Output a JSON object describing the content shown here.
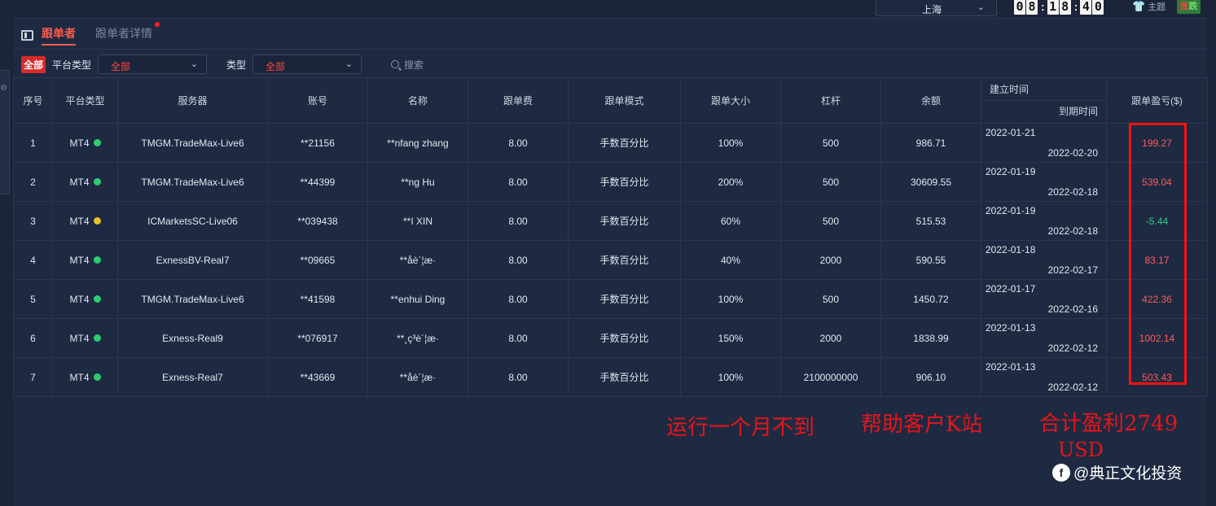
{
  "topbar": {
    "city": "上海",
    "clock_digits": [
      "0",
      "8",
      "1",
      "8",
      "4",
      "0"
    ],
    "theme_label": "主题",
    "zd_badge": {
      "z": "涨",
      "d": "跌"
    }
  },
  "tabs": [
    {
      "label": "跟单者",
      "active": true
    },
    {
      "label": "跟单者详情",
      "active": false
    }
  ],
  "filters": {
    "all_badge": "全部",
    "platform_label": "平台类型",
    "platform_value": "全部",
    "type_label": "类型",
    "type_value": "全部",
    "search_placeholder": "搜索"
  },
  "table": {
    "headers": {
      "seq": "序号",
      "platform": "平台类型",
      "server": "服务器",
      "account": "账号",
      "name": "名称",
      "fee": "跟单费",
      "mode": "跟单模式",
      "size": "跟单大小",
      "leverage": "杠杆",
      "balance": "余额",
      "created": "建立时间",
      "expiry": "到期时间",
      "pnl": "跟单盈亏($)"
    },
    "rows": [
      {
        "seq": "1",
        "platform": "MT4",
        "status": "green",
        "server": "TMGM.TradeMax-Live6",
        "account": "**21156",
        "name": "**nfang zhang",
        "fee": "8.00",
        "mode": "手数百分比",
        "size": "100%",
        "leverage": "500",
        "balance": "986.71",
        "created": "2022-01-21",
        "expiry": "2022-02-20",
        "pnl": "199.27",
        "pnl_sign": "pos"
      },
      {
        "seq": "2",
        "platform": "MT4",
        "status": "green",
        "server": "TMGM.TradeMax-Live6",
        "account": "**44399",
        "name": "**ng Hu",
        "fee": "8.00",
        "mode": "手数百分比",
        "size": "200%",
        "leverage": "500",
        "balance": "30609.55",
        "created": "2022-01-19",
        "expiry": "2022-02-18",
        "pnl": "539.04",
        "pnl_sign": "pos"
      },
      {
        "seq": "3",
        "platform": "MT4",
        "status": "yellow",
        "server": "ICMarketsSC-Live06",
        "account": "**039438",
        "name": "**I XIN",
        "fee": "8.00",
        "mode": "手数百分比",
        "size": "60%",
        "leverage": "500",
        "balance": "515.53",
        "created": "2022-01-19",
        "expiry": "2022-02-18",
        "pnl": "-5.44",
        "pnl_sign": "neg"
      },
      {
        "seq": "4",
        "platform": "MT4",
        "status": "green",
        "server": "ExnessBV-Real7",
        "account": "**09665",
        "name": "**åè´¦æ·",
        "fee": "8.00",
        "mode": "手数百分比",
        "size": "40%",
        "leverage": "2000",
        "balance": "590.55",
        "created": "2022-01-18",
        "expiry": "2022-02-17",
        "pnl": "83.17",
        "pnl_sign": "pos"
      },
      {
        "seq": "5",
        "platform": "MT4",
        "status": "green",
        "server": "TMGM.TradeMax-Live6",
        "account": "**41598",
        "name": "**enhui Ding",
        "fee": "8.00",
        "mode": "手数百分比",
        "size": "100%",
        "leverage": "500",
        "balance": "1450.72",
        "created": "2022-01-17",
        "expiry": "2022-02-16",
        "pnl": "422.36",
        "pnl_sign": "pos"
      },
      {
        "seq": "6",
        "platform": "MT4",
        "status": "green",
        "server": "Exness-Real9",
        "account": "**076917",
        "name": "**¸ç³è´¦æ·",
        "fee": "8.00",
        "mode": "手数百分比",
        "size": "150%",
        "leverage": "2000",
        "balance": "1838.99",
        "created": "2022-01-13",
        "expiry": "2022-02-12",
        "pnl": "1002.14",
        "pnl_sign": "pos"
      },
      {
        "seq": "7",
        "platform": "MT4",
        "status": "green",
        "server": "Exness-Real7",
        "account": "**43669",
        "name": "**åè´¦æ·",
        "fee": "8.00",
        "mode": "手数百分比",
        "size": "100%",
        "leverage": "2100000000",
        "balance": "906.10",
        "created": "2022-01-13",
        "expiry": "2022-02-12",
        "pnl": "503.43",
        "pnl_sign": "pos"
      }
    ]
  },
  "colors": {
    "status_green": "#2ecc71",
    "status_yellow": "#e6c229",
    "profit": "#ff5a5a",
    "loss": "#2ecc8a",
    "accent": "#ff5a4a"
  },
  "annotations": {
    "a1": "运行一个月不到",
    "a2": "帮助客户K站",
    "a3": "合计盈利2749",
    "a4": "USD"
  },
  "watermark": "@典正文化投资"
}
